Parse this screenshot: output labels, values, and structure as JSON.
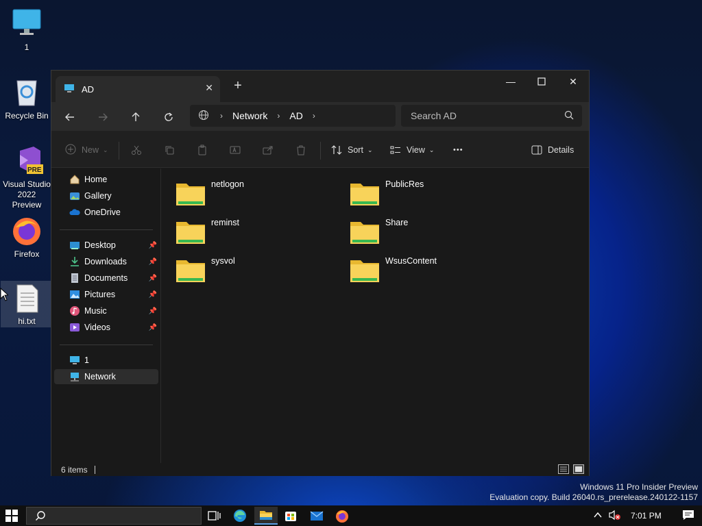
{
  "desktop": {
    "icons": [
      {
        "label": "1"
      },
      {
        "label": "Recycle Bin"
      },
      {
        "label": "Visual Studio 2022 Preview",
        "badge": "PRE"
      },
      {
        "label": "Firefox"
      },
      {
        "label": "hi.txt"
      }
    ]
  },
  "window": {
    "tab_title": "AD",
    "new_tab": "+",
    "address": {
      "crumbs": [
        "Network",
        "AD"
      ]
    },
    "search": {
      "placeholder": "Search AD"
    },
    "toolbar": {
      "new_label": "New",
      "sort_label": "Sort",
      "view_label": "View",
      "more_label": "•••",
      "details_label": "Details"
    },
    "sidebar": {
      "top": [
        {
          "label": "Home"
        },
        {
          "label": "Gallery"
        },
        {
          "label": "OneDrive"
        }
      ],
      "pinned": [
        {
          "label": "Desktop"
        },
        {
          "label": "Downloads"
        },
        {
          "label": "Documents"
        },
        {
          "label": "Pictures"
        },
        {
          "label": "Music"
        },
        {
          "label": "Videos"
        }
      ],
      "bottom": [
        {
          "label": "1"
        },
        {
          "label": "Network"
        }
      ]
    },
    "items": [
      {
        "name": "netlogon"
      },
      {
        "name": "PublicRes"
      },
      {
        "name": "reminst"
      },
      {
        "name": "Share"
      },
      {
        "name": "sysvol"
      },
      {
        "name": "WsusContent"
      }
    ],
    "status": {
      "count": "6 items"
    }
  },
  "watermark": {
    "line1": "Windows 11 Pro Insider Preview",
    "line2": "Evaluation copy. Build 26040.rs_prerelease.240122-1157"
  },
  "taskbar": {
    "clock": "7:01 PM"
  },
  "colors": {
    "folder": "#f5c542",
    "accent": "#5aa0e6",
    "window_bg": "#191919"
  }
}
